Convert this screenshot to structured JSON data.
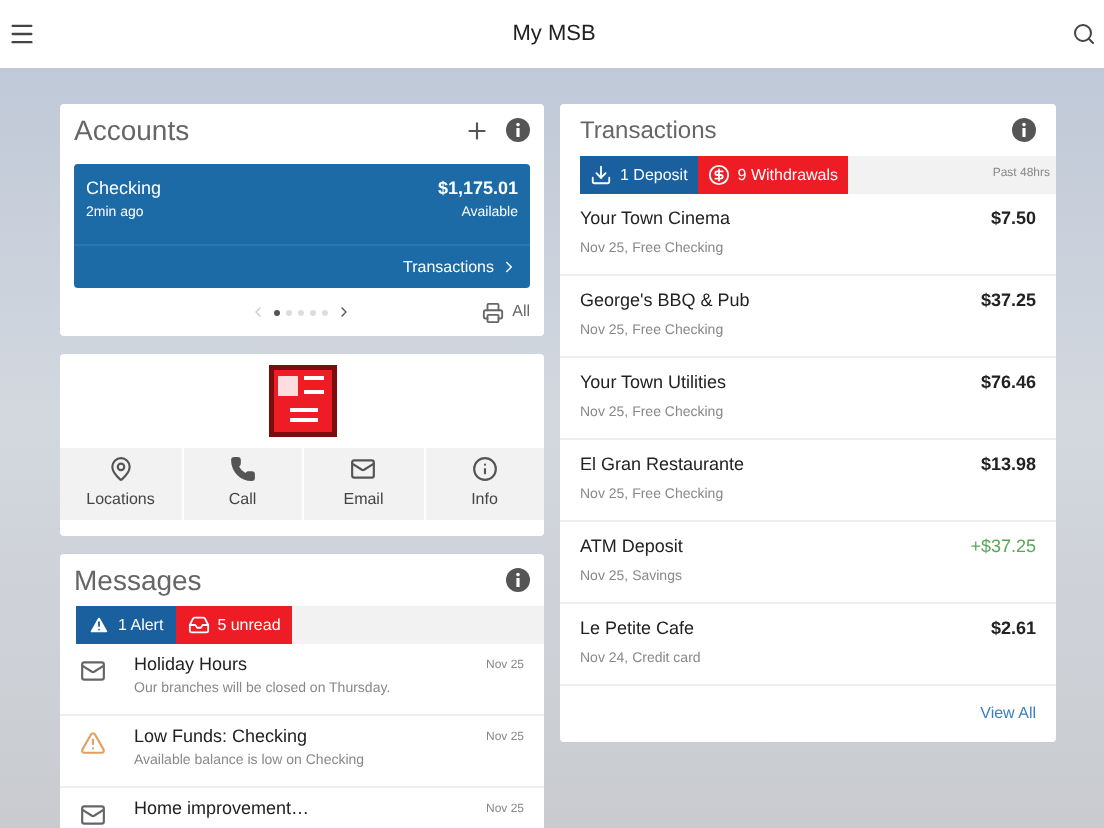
{
  "header": {
    "title": "My MSB"
  },
  "accounts": {
    "title": "Accounts",
    "account": {
      "name": "Checking",
      "updated": "2min ago",
      "balance": "$1,175.01",
      "balance_label": "Available",
      "link": "Transactions"
    },
    "pager": [
      {
        "selected": true
      },
      {
        "selected": false
      },
      {
        "selected": false
      },
      {
        "selected": false
      },
      {
        "selected": false
      }
    ],
    "all_label": "All"
  },
  "quick_actions": [
    {
      "kind": "pin",
      "label": "Locations"
    },
    {
      "kind": "phone",
      "label": "Call"
    },
    {
      "kind": "mail",
      "label": "Email"
    },
    {
      "kind": "info",
      "label": "Info"
    }
  ],
  "messages": {
    "title": "Messages",
    "filters": [
      {
        "kind": "alert",
        "label": "1 Alert"
      },
      {
        "kind": "unread",
        "label": "5 unread"
      }
    ],
    "items": [
      {
        "kind": "mail",
        "title": "Holiday Hours",
        "body": "Our branches will be closed on Thursday.",
        "date": "Nov 25"
      },
      {
        "kind": "warning",
        "title": "Low Funds: Checking",
        "body": "Available balance is low on Checking",
        "date": "Nov 25"
      },
      {
        "kind": "mail",
        "title": "Home improvement…",
        "date": "Nov 25"
      }
    ]
  },
  "transactions": {
    "title": "Transactions",
    "filters": [
      {
        "kind": "deposit",
        "label": "1 Deposit"
      },
      {
        "kind": "withdrawal",
        "label": "9 Withdrawals"
      }
    ],
    "period": "Past 48hrs",
    "rows": [
      {
        "kind": "debit",
        "name": "Your Town Cinema",
        "detail": "Nov 25, Free Checking",
        "amount": "$7.50"
      },
      {
        "kind": "debit",
        "name": "George's BBQ & Pub",
        "detail": "Nov 25, Free Checking",
        "amount": "$37.25"
      },
      {
        "kind": "debit",
        "name": "Your Town Utilities",
        "detail": "Nov 25, Free Checking",
        "amount": "$76.46"
      },
      {
        "kind": "debit",
        "name": "El Gran Restaurante",
        "detail": "Nov 25, Free Checking",
        "amount": "$13.98"
      },
      {
        "kind": "credit",
        "name": "ATM Deposit",
        "detail": "Nov 25, Savings",
        "amount": "+$37.25"
      },
      {
        "kind": "debit",
        "name": "Le Petite Cafe",
        "detail": "Nov 24, Credit card",
        "amount": "$2.61"
      }
    ],
    "view_all": "View All"
  }
}
